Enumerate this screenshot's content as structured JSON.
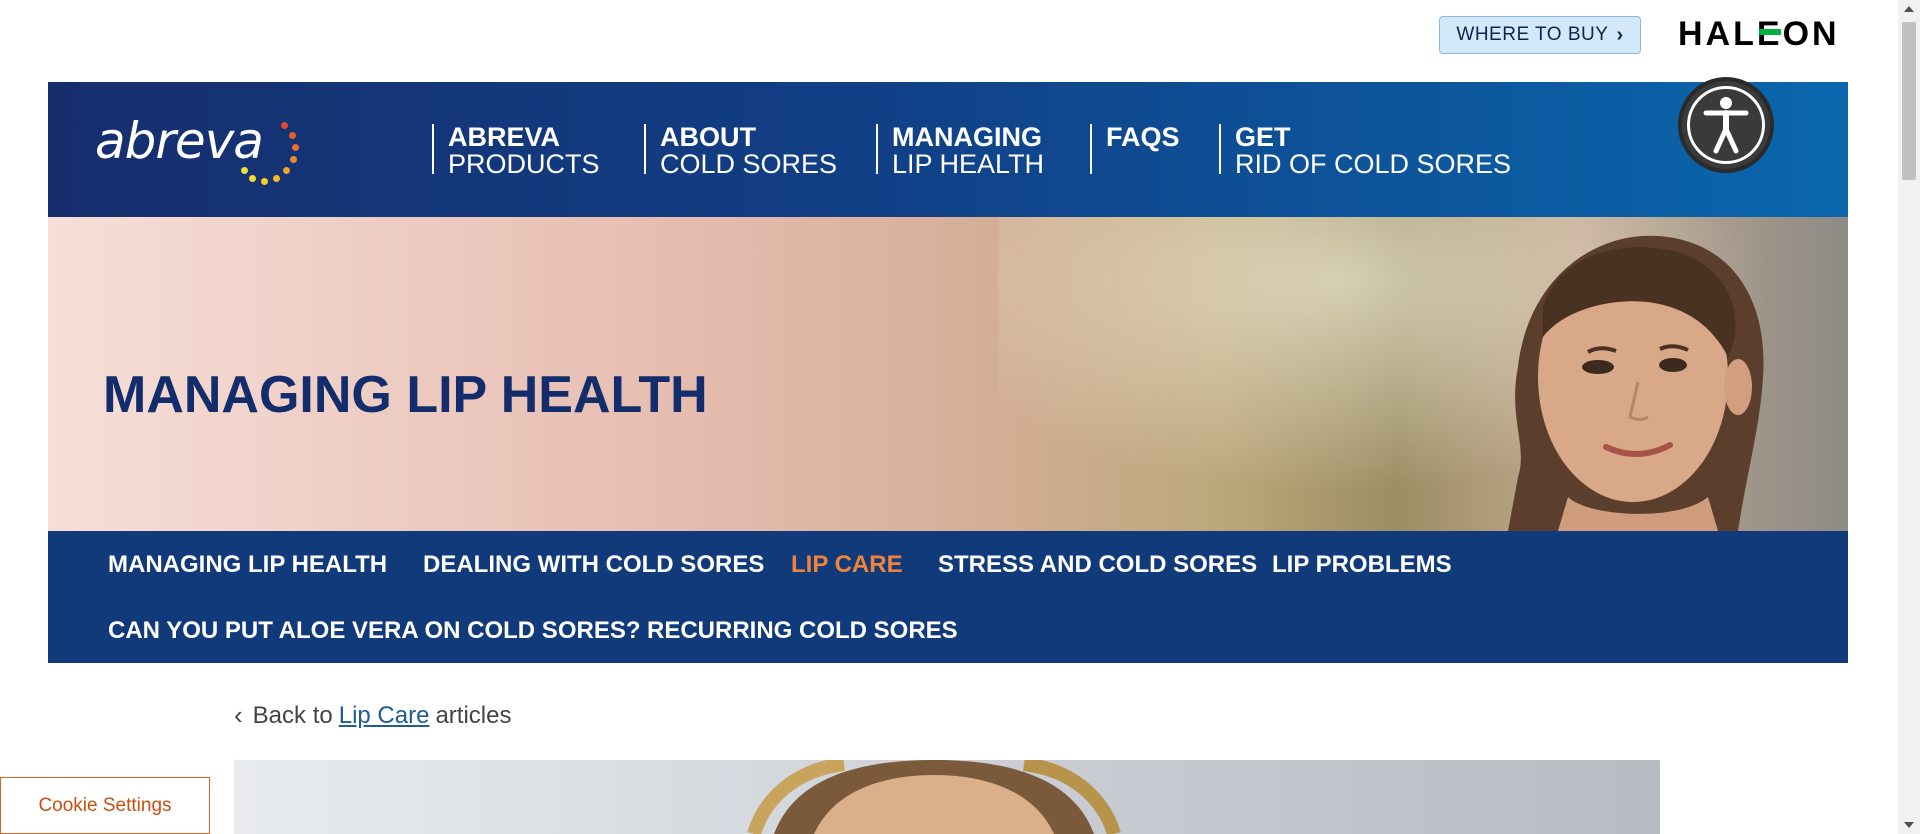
{
  "utility": {
    "where_to_buy": "WHERE TO BUY",
    "brand": "HALEON"
  },
  "header": {
    "logo_text": "abreva",
    "nav": [
      {
        "line1": "ABREVA",
        "line2": "PRODUCTS"
      },
      {
        "line1": "ABOUT",
        "line2": "COLD SORES"
      },
      {
        "line1": "MANAGING",
        "line2": "LIP HEALTH"
      },
      {
        "line1": "FAQS",
        "line2": ""
      },
      {
        "line1": "GET",
        "line2": "RID OF COLD SORES"
      }
    ]
  },
  "hero": {
    "title": "MANAGING LIP HEALTH"
  },
  "subnav": {
    "items": [
      {
        "label": "MANAGING LIP HEALTH",
        "active": false
      },
      {
        "label": "DEALING WITH COLD SORES",
        "active": false
      },
      {
        "label": "LIP CARE",
        "active": true
      },
      {
        "label": "STRESS AND COLD SORES",
        "active": false
      },
      {
        "label": "LIP PROBLEMS",
        "active": false
      },
      {
        "label": "CAN YOU PUT ALOE VERA ON COLD SORES?",
        "active": false
      },
      {
        "label": "RECURRING COLD SORES",
        "active": false
      }
    ]
  },
  "back": {
    "prefix": "Back to",
    "link": "Lip Care",
    "suffix": "articles"
  },
  "cookie": {
    "label": "Cookie Settings"
  },
  "colors": {
    "header_start": "#162e6e",
    "header_end": "#0a67ad",
    "subnav_bg": "#113a7a",
    "active_accent": "#f0833c",
    "title_color": "#132d6c",
    "haleon_green": "#00b140"
  },
  "icons": [
    "chevron-right-icon",
    "accessibility-icon",
    "chevron-left-icon"
  ]
}
